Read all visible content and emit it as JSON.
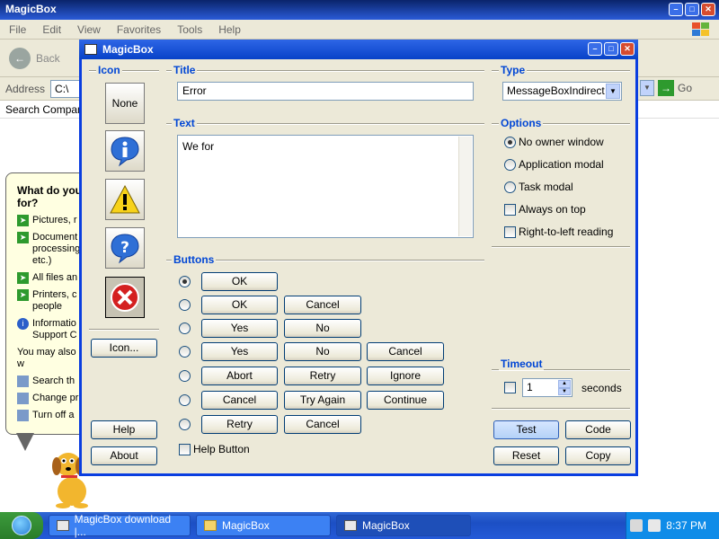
{
  "background_window": {
    "title": "MagicBox",
    "menu": [
      "File",
      "Edit",
      "View",
      "Favorites",
      "Tools",
      "Help"
    ],
    "back_label": "Back",
    "address_label": "Address",
    "address_value": "C:\\",
    "go_label": "Go",
    "search_label": "Search Compani"
  },
  "balloon": {
    "heading": "What do you\nfor?",
    "items": [
      "Pictures, r",
      "Document\nprocessing\netc.)",
      "All files an",
      "Printers, c\npeople",
      "Informatio\nSupport C"
    ],
    "may_also": "You may also w",
    "sub_items": [
      "Search th",
      "Change pr",
      "Turn off a"
    ]
  },
  "dialog": {
    "title": "MagicBox",
    "icon_section": "Icon",
    "icon_none_label": "None",
    "icon_custom_label": "Icon...",
    "help_label": "Help",
    "about_label": "About",
    "title_section": "Title",
    "title_value": "Error",
    "text_section": "Text",
    "text_value": "We for",
    "type_section": "Type",
    "type_value": "MessageBoxIndirect",
    "options_section": "Options",
    "options": [
      "No owner window",
      "Application modal",
      "Task modal"
    ],
    "checks": [
      "Always on top",
      "Right-to-left reading"
    ],
    "buttons_section": "Buttons",
    "button_rows": [
      [
        "OK"
      ],
      [
        "OK",
        "Cancel"
      ],
      [
        "Yes",
        "No"
      ],
      [
        "Yes",
        "No",
        "Cancel"
      ],
      [
        "Abort",
        "Retry",
        "Ignore"
      ],
      [
        "Cancel",
        "Try Again",
        "Continue"
      ],
      [
        "Retry",
        "Cancel"
      ]
    ],
    "help_button_label": "Help Button",
    "timeout_section": "Timeout",
    "timeout_value": "1",
    "timeout_unit": "seconds",
    "test_label": "Test",
    "code_label": "Code",
    "reset_label": "Reset",
    "copy_label": "Copy"
  },
  "taskbar": {
    "tasks": [
      "MagicBox download |...",
      "MagicBox",
      "MagicBox"
    ],
    "clock": "8:37 PM"
  }
}
